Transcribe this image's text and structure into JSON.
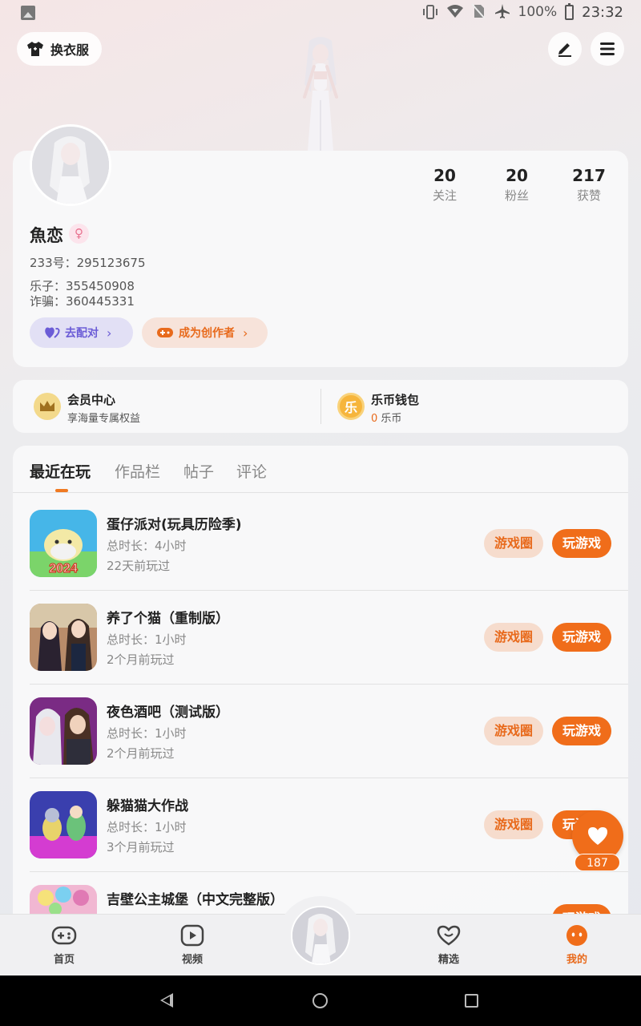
{
  "status_bar": {
    "battery": "100%",
    "time": "23:32"
  },
  "header": {
    "wardrobe_label": "换衣服"
  },
  "profile": {
    "name": "魚恋",
    "stats": [
      {
        "value": "20",
        "label": "关注"
      },
      {
        "value": "20",
        "label": "粉丝"
      },
      {
        "value": "217",
        "label": "获赞"
      }
    ],
    "id_line": "233号：295123675",
    "bio_line1": "乐子：355450908",
    "bio_line2": "诈骗：360445331",
    "match_label": "去配对",
    "creator_label": "成为创作者"
  },
  "member": {
    "title": "会员中心",
    "subtitle": "享海量专属权益"
  },
  "wallet": {
    "title": "乐币钱包",
    "amount": "0",
    "unit": "乐币",
    "coin_glyph": "乐"
  },
  "tabs": [
    {
      "label": "最近在玩",
      "active": true
    },
    {
      "label": "作品栏",
      "active": false
    },
    {
      "label": "帖子",
      "active": false
    },
    {
      "label": "评论",
      "active": false
    }
  ],
  "games": [
    {
      "title": "蛋仔派对(玩具历险季)",
      "duration": "总时长：4小时",
      "last_played": "22天前玩过",
      "thumb_text": "2024",
      "circle_label": "游戏圈",
      "play_label": "玩游戏"
    },
    {
      "title": "养了个猫（重制版）",
      "duration": "总时长：1小时",
      "last_played": "2个月前玩过",
      "circle_label": "游戏圈",
      "play_label": "玩游戏"
    },
    {
      "title": "夜色酒吧（测试版）",
      "duration": "总时长：1小时",
      "last_played": "2个月前玩过",
      "circle_label": "游戏圈",
      "play_label": "玩游戏"
    },
    {
      "title": "躲猫猫大作战",
      "duration": "总时长：1小时",
      "last_played": "3个月前玩过",
      "circle_label": "游戏圈",
      "play_label": "玩游戏"
    },
    {
      "title": "吉壁公主城堡（中文完整版）",
      "duration": "",
      "last_played": "",
      "circle_label": "",
      "play_label": "玩游戏"
    }
  ],
  "like_fab": {
    "count": "187"
  },
  "bottom_nav": [
    {
      "label": "首页",
      "active": false
    },
    {
      "label": "视频",
      "active": false
    },
    {
      "label": "精选",
      "active": false
    },
    {
      "label": "我的",
      "active": true
    }
  ],
  "colors": {
    "accent": "#f06d1a",
    "match_purple": "#6b5cd6"
  }
}
